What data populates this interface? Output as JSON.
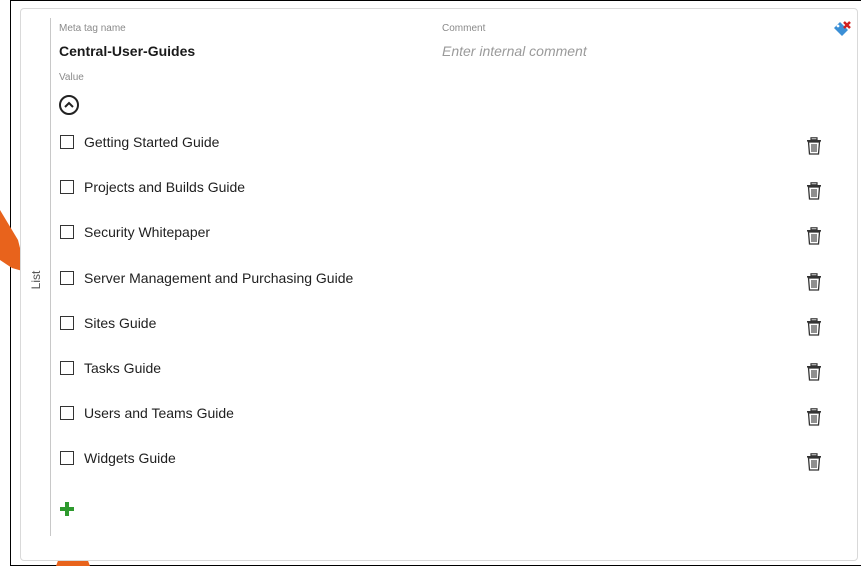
{
  "header": {
    "meta_tag_label": "Meta tag name",
    "meta_tag_value": "Central-User-Guides",
    "comment_label": "Comment",
    "comment_placeholder": "Enter internal comment",
    "value_label": "Value",
    "side_label": "List"
  },
  "items": [
    {
      "label": "Getting Started Guide",
      "checked": false
    },
    {
      "label": "Projects and Builds Guide",
      "checked": false
    },
    {
      "label": "Security Whitepaper",
      "checked": false
    },
    {
      "label": "Server Management and Purchasing Guide",
      "checked": false
    },
    {
      "label": "Sites Guide",
      "checked": false
    },
    {
      "label": "Tasks Guide",
      "checked": false
    },
    {
      "label": "Users and Teams Guide",
      "checked": false
    },
    {
      "label": "Widgets Guide",
      "checked": false
    }
  ],
  "icons": {
    "collapse": "chevron-up-icon",
    "tag": "tag-remove-icon",
    "trash": "trash-icon",
    "add": "plus-icon"
  },
  "colors": {
    "add_green": "#2e9a2e",
    "callout_orange": "#e8631c",
    "tag_blue": "#3b8fd6",
    "tag_red": "#d11f1f"
  }
}
